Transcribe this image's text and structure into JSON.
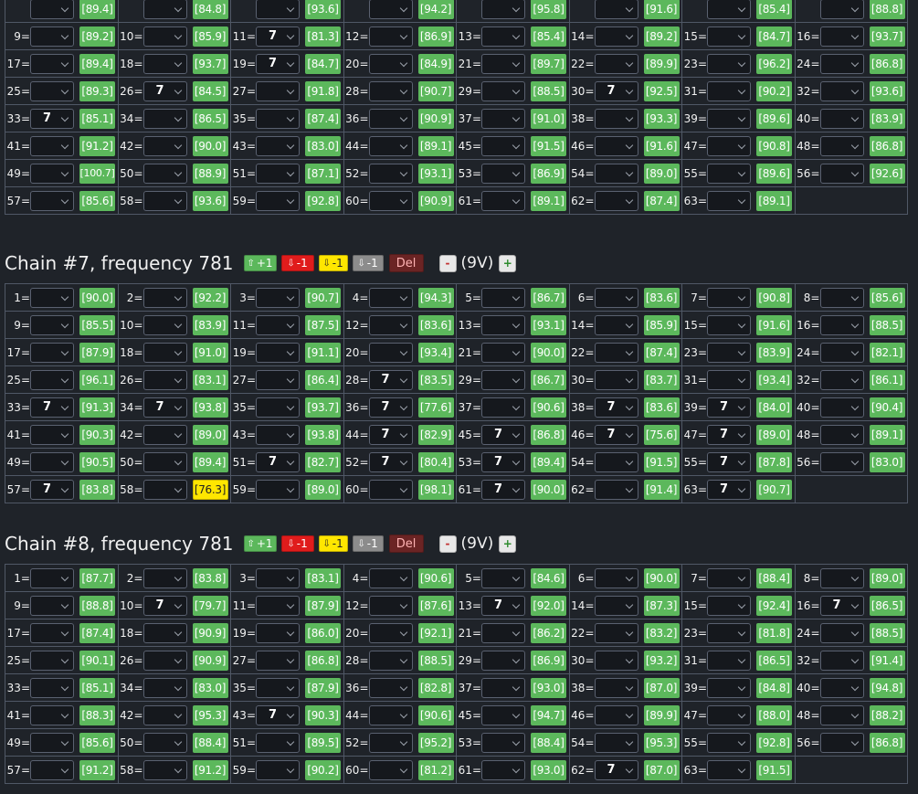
{
  "chains": [
    {
      "title": "",
      "show_header": false,
      "cells": [
        {
          "label": "",
          "sel": "",
          "val": "89.4"
        },
        {
          "label": "",
          "sel": "",
          "val": "84.8"
        },
        {
          "label": "",
          "sel": "",
          "val": "93.6"
        },
        {
          "label": "",
          "sel": "",
          "val": "94.2"
        },
        {
          "label": "",
          "sel": "",
          "val": "95.8"
        },
        {
          "label": "",
          "sel": "",
          "val": "91.6"
        },
        {
          "label": "",
          "sel": "",
          "val": "85.4"
        },
        {
          "label": "",
          "sel": "",
          "val": "88.8"
        },
        {
          "label": "9=",
          "sel": "",
          "val": "89.2"
        },
        {
          "label": "10=",
          "sel": "",
          "val": "85.9"
        },
        {
          "label": "11=",
          "sel": "7",
          "val": "81.3"
        },
        {
          "label": "12=",
          "sel": "",
          "val": "86.9"
        },
        {
          "label": "13=",
          "sel": "",
          "val": "85.4"
        },
        {
          "label": "14=",
          "sel": "",
          "val": "89.2"
        },
        {
          "label": "15=",
          "sel": "",
          "val": "84.7"
        },
        {
          "label": "16=",
          "sel": "",
          "val": "93.7"
        },
        {
          "label": "17=",
          "sel": "",
          "val": "89.4"
        },
        {
          "label": "18=",
          "sel": "",
          "val": "93.7"
        },
        {
          "label": "19=",
          "sel": "7",
          "val": "84.7"
        },
        {
          "label": "20=",
          "sel": "",
          "val": "84.9"
        },
        {
          "label": "21=",
          "sel": "",
          "val": "89.7"
        },
        {
          "label": "22=",
          "sel": "",
          "val": "89.9"
        },
        {
          "label": "23=",
          "sel": "",
          "val": "96.2"
        },
        {
          "label": "24=",
          "sel": "",
          "val": "86.8"
        },
        {
          "label": "25=",
          "sel": "",
          "val": "89.3"
        },
        {
          "label": "26=",
          "sel": "7",
          "val": "84.5"
        },
        {
          "label": "27=",
          "sel": "",
          "val": "91.8"
        },
        {
          "label": "28=",
          "sel": "",
          "val": "90.7"
        },
        {
          "label": "29=",
          "sel": "",
          "val": "88.5"
        },
        {
          "label": "30=",
          "sel": "7",
          "val": "92.5"
        },
        {
          "label": "31=",
          "sel": "",
          "val": "90.2"
        },
        {
          "label": "32=",
          "sel": "",
          "val": "93.6"
        },
        {
          "label": "33=",
          "sel": "7",
          "val": "85.1"
        },
        {
          "label": "34=",
          "sel": "",
          "val": "86.5"
        },
        {
          "label": "35=",
          "sel": "",
          "val": "87.4"
        },
        {
          "label": "36=",
          "sel": "",
          "val": "90.9"
        },
        {
          "label": "37=",
          "sel": "",
          "val": "91.0"
        },
        {
          "label": "38=",
          "sel": "",
          "val": "93.3"
        },
        {
          "label": "39=",
          "sel": "",
          "val": "89.6"
        },
        {
          "label": "40=",
          "sel": "",
          "val": "83.9"
        },
        {
          "label": "41=",
          "sel": "",
          "val": "91.2"
        },
        {
          "label": "42=",
          "sel": "",
          "val": "90.0"
        },
        {
          "label": "43=",
          "sel": "",
          "val": "83.0"
        },
        {
          "label": "44=",
          "sel": "",
          "val": "89.1"
        },
        {
          "label": "45=",
          "sel": "",
          "val": "91.5"
        },
        {
          "label": "46=",
          "sel": "",
          "val": "91.6"
        },
        {
          "label": "47=",
          "sel": "",
          "val": "90.8"
        },
        {
          "label": "48=",
          "sel": "",
          "val": "86.8"
        },
        {
          "label": "49=",
          "sel": "",
          "val": "100.7"
        },
        {
          "label": "50=",
          "sel": "",
          "val": "88.9"
        },
        {
          "label": "51=",
          "sel": "",
          "val": "87.1"
        },
        {
          "label": "52=",
          "sel": "",
          "val": "93.1"
        },
        {
          "label": "53=",
          "sel": "",
          "val": "86.9"
        },
        {
          "label": "54=",
          "sel": "",
          "val": "89.0"
        },
        {
          "label": "55=",
          "sel": "",
          "val": "89.6"
        },
        {
          "label": "56=",
          "sel": "",
          "val": "92.6"
        },
        {
          "label": "57=",
          "sel": "",
          "val": "85.6"
        },
        {
          "label": "58=",
          "sel": "",
          "val": "93.6"
        },
        {
          "label": "59=",
          "sel": "",
          "val": "92.8"
        },
        {
          "label": "60=",
          "sel": "",
          "val": "90.9"
        },
        {
          "label": "61=",
          "sel": "",
          "val": "89.1"
        },
        {
          "label": "62=",
          "sel": "",
          "val": "87.4"
        },
        {
          "label": "63=",
          "sel": "",
          "val": "89.1"
        }
      ]
    },
    {
      "title": "Chain #7, frequency 781",
      "show_header": true,
      "cells": [
        {
          "label": "1=",
          "sel": "",
          "val": "90.0"
        },
        {
          "label": "2=",
          "sel": "",
          "val": "92.2"
        },
        {
          "label": "3=",
          "sel": "",
          "val": "90.7"
        },
        {
          "label": "4=",
          "sel": "",
          "val": "94.3"
        },
        {
          "label": "5=",
          "sel": "",
          "val": "86.7"
        },
        {
          "label": "6=",
          "sel": "",
          "val": "83.6"
        },
        {
          "label": "7=",
          "sel": "",
          "val": "90.8"
        },
        {
          "label": "8=",
          "sel": "",
          "val": "85.6"
        },
        {
          "label": "9=",
          "sel": "",
          "val": "85.5"
        },
        {
          "label": "10=",
          "sel": "",
          "val": "83.9"
        },
        {
          "label": "11=",
          "sel": "",
          "val": "87.5"
        },
        {
          "label": "12=",
          "sel": "",
          "val": "83.6"
        },
        {
          "label": "13=",
          "sel": "",
          "val": "93.1"
        },
        {
          "label": "14=",
          "sel": "",
          "val": "85.9"
        },
        {
          "label": "15=",
          "sel": "",
          "val": "91.6"
        },
        {
          "label": "16=",
          "sel": "",
          "val": "88.5"
        },
        {
          "label": "17=",
          "sel": "",
          "val": "87.9"
        },
        {
          "label": "18=",
          "sel": "",
          "val": "91.0"
        },
        {
          "label": "19=",
          "sel": "",
          "val": "91.1"
        },
        {
          "label": "20=",
          "sel": "",
          "val": "93.4"
        },
        {
          "label": "21=",
          "sel": "",
          "val": "90.0"
        },
        {
          "label": "22=",
          "sel": "",
          "val": "87.4"
        },
        {
          "label": "23=",
          "sel": "",
          "val": "83.9"
        },
        {
          "label": "24=",
          "sel": "",
          "val": "82.1"
        },
        {
          "label": "25=",
          "sel": "",
          "val": "96.1"
        },
        {
          "label": "26=",
          "sel": "",
          "val": "83.1"
        },
        {
          "label": "27=",
          "sel": "",
          "val": "86.4"
        },
        {
          "label": "28=",
          "sel": "7",
          "val": "83.5"
        },
        {
          "label": "29=",
          "sel": "",
          "val": "86.7"
        },
        {
          "label": "30=",
          "sel": "",
          "val": "83.7"
        },
        {
          "label": "31=",
          "sel": "",
          "val": "93.4"
        },
        {
          "label": "32=",
          "sel": "",
          "val": "86.1"
        },
        {
          "label": "33=",
          "sel": "7",
          "val": "91.3"
        },
        {
          "label": "34=",
          "sel": "7",
          "val": "93.8"
        },
        {
          "label": "35=",
          "sel": "",
          "val": "93.7"
        },
        {
          "label": "36=",
          "sel": "7",
          "val": "77.6"
        },
        {
          "label": "37=",
          "sel": "",
          "val": "90.6"
        },
        {
          "label": "38=",
          "sel": "7",
          "val": "83.6"
        },
        {
          "label": "39=",
          "sel": "7",
          "val": "84.0"
        },
        {
          "label": "40=",
          "sel": "",
          "val": "90.4"
        },
        {
          "label": "41=",
          "sel": "",
          "val": "90.3"
        },
        {
          "label": "42=",
          "sel": "",
          "val": "89.0"
        },
        {
          "label": "43=",
          "sel": "",
          "val": "93.8"
        },
        {
          "label": "44=",
          "sel": "7",
          "val": "82.9"
        },
        {
          "label": "45=",
          "sel": "7",
          "val": "86.8"
        },
        {
          "label": "46=",
          "sel": "7",
          "val": "75.6"
        },
        {
          "label": "47=",
          "sel": "7",
          "val": "89.0"
        },
        {
          "label": "48=",
          "sel": "",
          "val": "89.1"
        },
        {
          "label": "49=",
          "sel": "",
          "val": "90.5"
        },
        {
          "label": "50=",
          "sel": "",
          "val": "89.4"
        },
        {
          "label": "51=",
          "sel": "7",
          "val": "82.7"
        },
        {
          "label": "52=",
          "sel": "7",
          "val": "80.4"
        },
        {
          "label": "53=",
          "sel": "7",
          "val": "89.4"
        },
        {
          "label": "54=",
          "sel": "",
          "val": "91.5"
        },
        {
          "label": "55=",
          "sel": "7",
          "val": "87.8"
        },
        {
          "label": "56=",
          "sel": "",
          "val": "83.0"
        },
        {
          "label": "57=",
          "sel": "7",
          "val": "83.8"
        },
        {
          "label": "58=",
          "sel": "",
          "val": "76.3",
          "warn": true
        },
        {
          "label": "59=",
          "sel": "",
          "val": "89.0"
        },
        {
          "label": "60=",
          "sel": "",
          "val": "98.1"
        },
        {
          "label": "61=",
          "sel": "7",
          "val": "90.0"
        },
        {
          "label": "62=",
          "sel": "",
          "val": "91.4"
        },
        {
          "label": "63=",
          "sel": "7",
          "val": "90.7"
        }
      ]
    },
    {
      "title": "Chain #8, frequency 781",
      "show_header": true,
      "cells": [
        {
          "label": "1=",
          "sel": "",
          "val": "87.7"
        },
        {
          "label": "2=",
          "sel": "",
          "val": "83.8"
        },
        {
          "label": "3=",
          "sel": "",
          "val": "83.1"
        },
        {
          "label": "4=",
          "sel": "",
          "val": "90.6"
        },
        {
          "label": "5=",
          "sel": "",
          "val": "84.6"
        },
        {
          "label": "6=",
          "sel": "",
          "val": "90.0"
        },
        {
          "label": "7=",
          "sel": "",
          "val": "88.4"
        },
        {
          "label": "8=",
          "sel": "",
          "val": "89.0"
        },
        {
          "label": "9=",
          "sel": "",
          "val": "88.8"
        },
        {
          "label": "10=",
          "sel": "7",
          "val": "79.7"
        },
        {
          "label": "11=",
          "sel": "",
          "val": "87.9"
        },
        {
          "label": "12=",
          "sel": "",
          "val": "87.6"
        },
        {
          "label": "13=",
          "sel": "7",
          "val": "92.0"
        },
        {
          "label": "14=",
          "sel": "",
          "val": "87.3"
        },
        {
          "label": "15=",
          "sel": "",
          "val": "92.4"
        },
        {
          "label": "16=",
          "sel": "7",
          "val": "86.5"
        },
        {
          "label": "17=",
          "sel": "",
          "val": "87.4"
        },
        {
          "label": "18=",
          "sel": "",
          "val": "90.9"
        },
        {
          "label": "19=",
          "sel": "",
          "val": "86.0"
        },
        {
          "label": "20=",
          "sel": "",
          "val": "92.1"
        },
        {
          "label": "21=",
          "sel": "",
          "val": "86.2"
        },
        {
          "label": "22=",
          "sel": "",
          "val": "83.2"
        },
        {
          "label": "23=",
          "sel": "",
          "val": "81.8"
        },
        {
          "label": "24=",
          "sel": "",
          "val": "88.5"
        },
        {
          "label": "25=",
          "sel": "",
          "val": "90.1"
        },
        {
          "label": "26=",
          "sel": "",
          "val": "90.9"
        },
        {
          "label": "27=",
          "sel": "",
          "val": "86.8"
        },
        {
          "label": "28=",
          "sel": "",
          "val": "88.5"
        },
        {
          "label": "29=",
          "sel": "",
          "val": "86.9"
        },
        {
          "label": "30=",
          "sel": "",
          "val": "93.2"
        },
        {
          "label": "31=",
          "sel": "",
          "val": "86.5"
        },
        {
          "label": "32=",
          "sel": "",
          "val": "91.4"
        },
        {
          "label": "33=",
          "sel": "",
          "val": "85.1"
        },
        {
          "label": "34=",
          "sel": "",
          "val": "83.0"
        },
        {
          "label": "35=",
          "sel": "",
          "val": "87.9"
        },
        {
          "label": "36=",
          "sel": "",
          "val": "82.8"
        },
        {
          "label": "37=",
          "sel": "",
          "val": "93.0"
        },
        {
          "label": "38=",
          "sel": "",
          "val": "87.0"
        },
        {
          "label": "39=",
          "sel": "",
          "val": "84.8"
        },
        {
          "label": "40=",
          "sel": "",
          "val": "94.8"
        },
        {
          "label": "41=",
          "sel": "",
          "val": "88.3"
        },
        {
          "label": "42=",
          "sel": "",
          "val": "95.3"
        },
        {
          "label": "43=",
          "sel": "7",
          "val": "90.3"
        },
        {
          "label": "44=",
          "sel": "",
          "val": "90.6"
        },
        {
          "label": "45=",
          "sel": "",
          "val": "94.7"
        },
        {
          "label": "46=",
          "sel": "",
          "val": "89.9"
        },
        {
          "label": "47=",
          "sel": "",
          "val": "88.0"
        },
        {
          "label": "48=",
          "sel": "",
          "val": "88.2"
        },
        {
          "label": "49=",
          "sel": "",
          "val": "85.6"
        },
        {
          "label": "50=",
          "sel": "",
          "val": "88.4"
        },
        {
          "label": "51=",
          "sel": "",
          "val": "89.5"
        },
        {
          "label": "52=",
          "sel": "",
          "val": "95.2"
        },
        {
          "label": "53=",
          "sel": "",
          "val": "88.4"
        },
        {
          "label": "54=",
          "sel": "",
          "val": "95.3"
        },
        {
          "label": "55=",
          "sel": "",
          "val": "92.8"
        },
        {
          "label": "56=",
          "sel": "",
          "val": "86.8"
        },
        {
          "label": "57=",
          "sel": "",
          "val": "91.2"
        },
        {
          "label": "58=",
          "sel": "",
          "val": "91.2"
        },
        {
          "label": "59=",
          "sel": "",
          "val": "90.2"
        },
        {
          "label": "60=",
          "sel": "",
          "val": "81.2"
        },
        {
          "label": "61=",
          "sel": "",
          "val": "93.0"
        },
        {
          "label": "62=",
          "sel": "7",
          "val": "87.0"
        },
        {
          "label": "63=",
          "sel": "",
          "val": "91.5"
        }
      ]
    }
  ],
  "header_buttons": {
    "up_label": "+1",
    "down_red_label": "-1",
    "down_yellow_label": "-1",
    "down_gray_label": "-1",
    "del_label": "Del",
    "minus_label": "-",
    "voltage_label": "(9V)",
    "plus_label": "+"
  },
  "icons": {
    "up": "arrow-up-icon",
    "down": "arrow-down-icon"
  },
  "colors": {
    "background": "#1f2329",
    "badge_green": "#5cb85c",
    "badge_warn": "#ffe600",
    "btn_red": "#e01c1c",
    "btn_gray": "#8c8c8c",
    "del_bg": "#6b2424"
  }
}
